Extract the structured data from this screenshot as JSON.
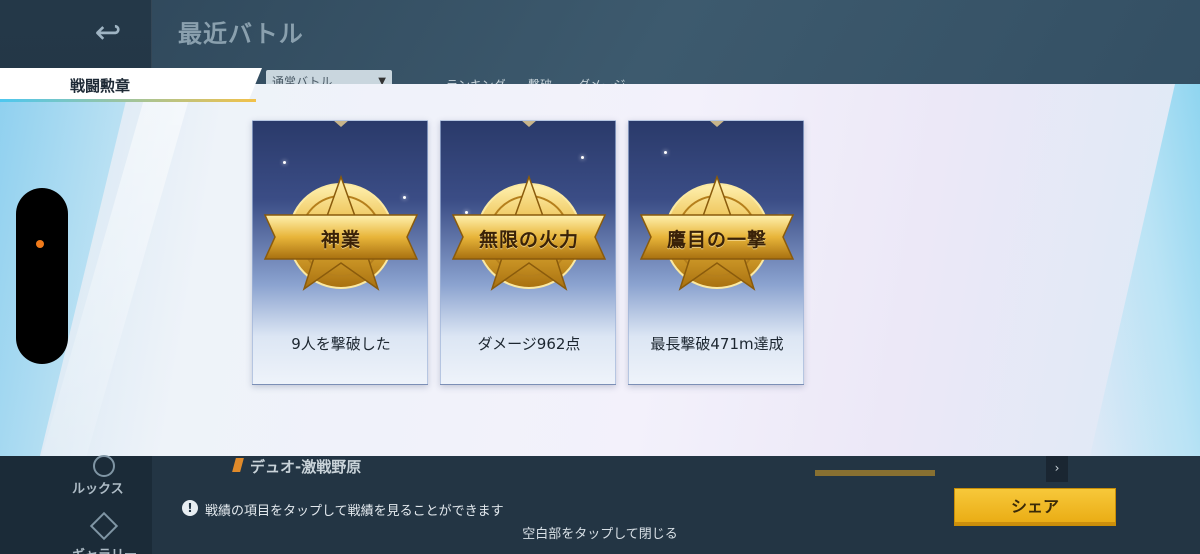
{
  "background": {
    "back_icon": "undo-arrow-icon",
    "title": "最近バトル",
    "mode_dropdown": "通常バトル",
    "tabs": [
      "ランキング",
      "撃破",
      "ダメージ"
    ],
    "nav": [
      {
        "icon": "ruksu-icon",
        "label": "ルックス"
      },
      {
        "icon": "gallery-icon",
        "label": "ギャラリー"
      }
    ],
    "match_row": {
      "mode": "デュオ-激戦野原"
    }
  },
  "section": {
    "title": "戦闘勲章"
  },
  "medals": [
    {
      "name": "神業",
      "description": "9人を撃破した"
    },
    {
      "name": "無限の火力",
      "description": "ダメージ962点"
    },
    {
      "name": "鷹目の一撃",
      "description": "最長撃破471m達成"
    }
  ],
  "footer": {
    "info_icon": "info-icon",
    "info_text": "戦績の項目をタップして戦績を見ることができます",
    "share_label": "シェア",
    "close_hint": "空白部をタップして閉じる"
  },
  "colors": {
    "share_button": "#f0b927",
    "accent_blue": "#4dc7f0",
    "medal_gold": "#e8b53a",
    "indicator_dot": "#f07a1a"
  }
}
